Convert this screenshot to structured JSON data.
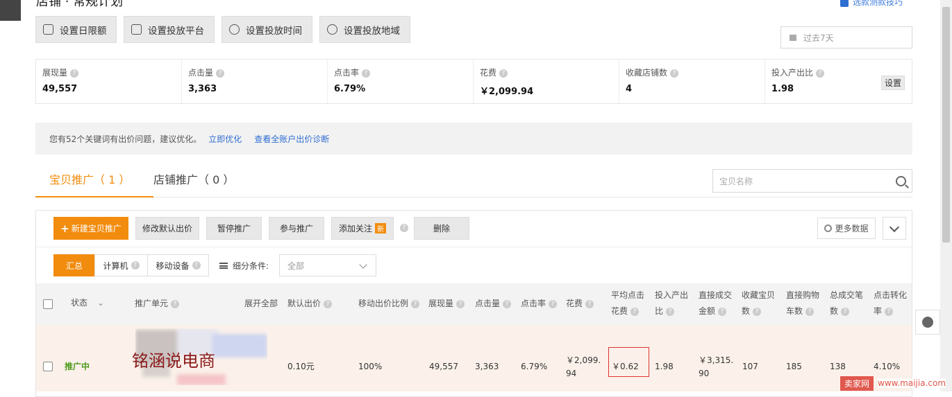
{
  "header": {
    "title_cut": "店铺 · 常规计划",
    "top_right_link": "选款测款技巧"
  },
  "toolbar_settings": [
    {
      "label": "设置日限额",
      "icon": "sliders-icon"
    },
    {
      "label": "设置投放平台",
      "icon": "screen-icon"
    },
    {
      "label": "设置投放时间",
      "icon": "clock-icon"
    },
    {
      "label": "设置投放地域",
      "icon": "map-pin-icon"
    }
  ],
  "date_filter": {
    "value": "过去7天"
  },
  "metrics": [
    {
      "label": "展现量",
      "value": "49,557"
    },
    {
      "label": "点击量",
      "value": "3,363"
    },
    {
      "label": "点击率",
      "value": "6.79%"
    },
    {
      "label": "花费",
      "value": "￥2,099.94"
    },
    {
      "label": "收藏店铺数",
      "value": "4"
    },
    {
      "label": "投入产出比",
      "value": "1.98",
      "action": "设置"
    }
  ],
  "notice": {
    "text": "您有52个关键词有出价问题，建议优化。",
    "link1": "立即优化",
    "link2": "查看全账户出价诊断"
  },
  "tabs": [
    {
      "label": "宝贝推广（ 1 ）",
      "active": true
    },
    {
      "label": "店铺推广（ 0 ）",
      "active": false
    }
  ],
  "search": {
    "placeholder": "宝贝名称"
  },
  "actions": {
    "new": "新建宝贝推广",
    "edit_bid": "修改默认出价",
    "pause": "暂停推广",
    "join": "参与推广",
    "follow": "添加关注",
    "follow_badge": "新",
    "delete": "删除",
    "more": "更多数据"
  },
  "segments": [
    "汇总",
    "计算机",
    "移动设备"
  ],
  "filter": {
    "label": "细分条件:",
    "value": "全部"
  },
  "table": {
    "headers": {
      "status": "状态",
      "unit": "推广单元",
      "expand": "展开全部",
      "default_bid": "默认出价",
      "mobile_ratio": "移动出价比例",
      "impressions": "展现量",
      "clicks": "点击量",
      "ctr": "点击率",
      "cost": "花费",
      "avg_cpc_1": "平均点击",
      "avg_cpc_2": "花费",
      "roi_1": "投入产出",
      "roi_2": "比",
      "gmv_1": "直接成交",
      "gmv_2": "金额",
      "fav_1": "收藏宝贝",
      "fav_2": "数",
      "cart_1": "直接购物",
      "cart_2": "车数",
      "orders_1": "总成交笔",
      "orders_2": "数",
      "cvr_1": "点击转化",
      "cvr_2": "率"
    },
    "rows": [
      {
        "status": "推广中",
        "unit_watermark": "铭涵说电商",
        "default_bid": "0.10元",
        "mobile_ratio": "100%",
        "impressions": "49,557",
        "clicks": "3,363",
        "ctr": "6.79%",
        "cost_1": "￥2,099.",
        "cost_2": "94",
        "avg_cpc": "￥0.62",
        "roi": "1.98",
        "gmv_1": "￥3,315.",
        "gmv_2": "90",
        "fav": "107",
        "cart": "185",
        "orders": "138",
        "cvr": "4.10%"
      }
    ]
  },
  "site_watermark": {
    "brand": "卖家网",
    "url": "www.maijia.com"
  }
}
